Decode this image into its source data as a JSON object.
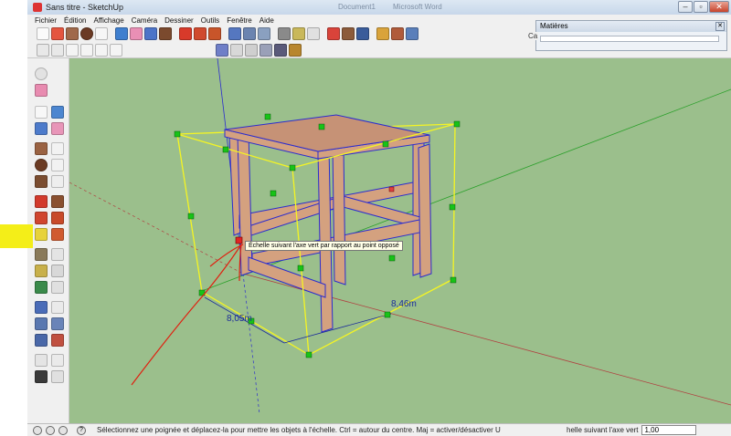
{
  "window": {
    "title": "Sans titre - SketchUp",
    "ghost_tabs": [
      "Document1",
      "Microsoft Word"
    ]
  },
  "menu": [
    "Fichier",
    "Édition",
    "Affichage",
    "Caméra",
    "Dessiner",
    "Outils",
    "Fenêtre",
    "Aide"
  ],
  "materials_panel": {
    "title": "Matières",
    "stub": "Ca"
  },
  "tooltip": "Échelle suivant l'axe vert par rapport au point opposé",
  "dimensions": {
    "left": "8,05m",
    "right": "8,46m"
  },
  "status": {
    "hint": "Sélectionnez une poignée et déplacez-la pour mettre les objets à l'échelle. Ctrl = autour du centre. Maj = activer/désactiver U",
    "vcb_label": "helle suivant l'axe vert",
    "vcb_value": "1,00"
  },
  "colors": {
    "viewport": "#9bbf8c",
    "wood": "#d4a17f",
    "edges": "#2b2ccf",
    "scale_box": "#f5f523",
    "grip": "#17c317",
    "highlight": "#f4ee18",
    "annotation": "#e02010"
  },
  "icons": {
    "toolbar_row1": [
      "select-arrow-icon",
      "pencil-icon",
      "rectangle-icon",
      "circle-icon",
      "arc-icon",
      "make-component-icon",
      "eraser-icon",
      "paint-bucket-icon",
      "push-pull-icon",
      "move-icon",
      "rotate-icon",
      "offset-icon",
      "orbit-icon",
      "zoom-icon",
      "zoom-extents-icon",
      "tape-measure-icon",
      "dimension-icon",
      "text-icon",
      "axes-icon",
      "walk-icon",
      "look-around-icon",
      "section-plane-icon",
      "warehouse-icon",
      "model-info-icon"
    ],
    "toolbar_row2": [
      "iso-view-icon",
      "top-view-icon",
      "front-view-icon",
      "right-view-icon",
      "back-view-icon",
      "left-view-icon",
      "xray-icon",
      "wireframe-icon",
      "hidden-line-icon",
      "shaded-icon",
      "shaded-texture-icon",
      "monochrome-icon"
    ]
  }
}
